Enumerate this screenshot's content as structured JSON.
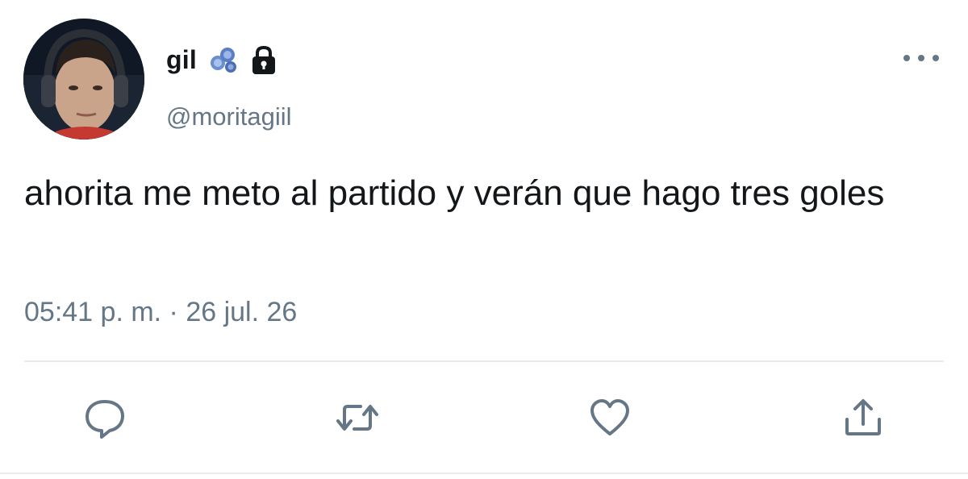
{
  "author": {
    "display_name": "gil",
    "handle": "@moritagiil",
    "avatar": "profile-photo",
    "badges": [
      "blue-gloves-emoji-icon",
      "lock-icon"
    ]
  },
  "tweet": {
    "text": "ahorita me meto al partido y verán que hago tres goles",
    "timestamp": "05:41 p. m. · 26 jul. 26"
  },
  "actions": [
    {
      "name": "reply",
      "icon": "speech-bubble-icon"
    },
    {
      "name": "retweet",
      "icon": "retweet-arrows-icon"
    },
    {
      "name": "like",
      "icon": "heart-icon"
    },
    {
      "name": "share",
      "icon": "upload-icon"
    }
  ],
  "colors": {
    "text_primary": "#14171a",
    "text_secondary": "#657786",
    "divider": "#e6ecf0",
    "icon": "#657786"
  }
}
